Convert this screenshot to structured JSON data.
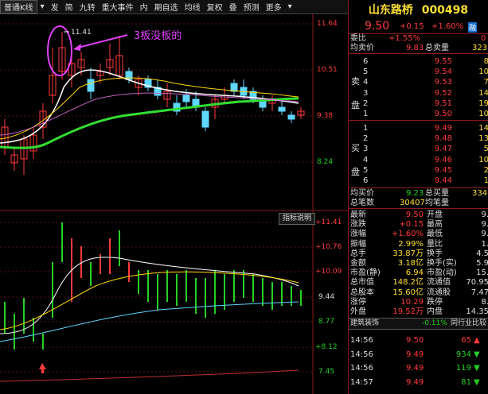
{
  "toolbar": {
    "items": [
      "普通K线",
      "发",
      "简",
      "九转",
      "重大事件",
      "内",
      "期自选",
      "均线",
      "复权",
      "叠",
      "预测",
      "更多"
    ]
  },
  "main_axis": {
    "ticks": [
      "11.64",
      "10.51",
      "9.38",
      "8.24"
    ]
  },
  "sub_axis": {
    "ticks": [
      "+11.41",
      "+10.76",
      "+10.09",
      "9.44",
      "8.77",
      "+8.12",
      "7.45"
    ]
  },
  "annotation": {
    "price_tag": "11.41",
    "note": "3板没板的"
  },
  "indicator_button": "指标说明",
  "stock": {
    "name": "山东路桥",
    "code": "000498",
    "price": "9.50",
    "change": "+0.15",
    "pct": "+1.60%",
    "flag": "融"
  },
  "weibi": {
    "label": "委比",
    "value": "+1.55%",
    "extra": "0"
  },
  "avg_row": {
    "l1": "均卖价",
    "v1": "9.83",
    "l2": "总卖量",
    "v2": "323"
  },
  "sell": {
    "side_label": "卖盘",
    "rows": [
      {
        "lvl": "6",
        "price": "9.55",
        "vol": "8"
      },
      {
        "lvl": "5",
        "price": "9.54",
        "vol": "10"
      },
      {
        "lvl": "4",
        "price": "9.53",
        "vol": "7"
      },
      {
        "lvl": "3",
        "price": "9.52",
        "vol": "14"
      },
      {
        "lvl": "2",
        "price": "9.51",
        "vol": "19"
      },
      {
        "lvl": "1",
        "price": "9.50",
        "vol": "10"
      }
    ]
  },
  "buy": {
    "side_label": "买盘",
    "rows": [
      {
        "lvl": "1",
        "price": "9.49",
        "vol": "14"
      },
      {
        "lvl": "2",
        "price": "9.48",
        "vol": "13"
      },
      {
        "lvl": "3",
        "price": "9.47",
        "vol": "5"
      },
      {
        "lvl": "4",
        "price": "9.46",
        "vol": "10"
      },
      {
        "lvl": "5",
        "price": "9.45",
        "vol": "2"
      },
      {
        "lvl": "6",
        "price": "9.44",
        "vol": "1"
      }
    ]
  },
  "avg_buy": {
    "l1": "均买价",
    "v1": "9.23",
    "l2": "总买量",
    "v2": "334"
  },
  "total_deals": {
    "l1": "总笔数",
    "v1": "30407",
    "l2": "均笔量",
    "v2": ""
  },
  "stats": [
    {
      "l1": "最新",
      "v1": "9.50",
      "c1": "red",
      "l2": "开盘",
      "v2": "9."
    },
    {
      "l1": "涨跌",
      "v1": "+0.15",
      "c1": "red",
      "l2": "最高",
      "v2": "9."
    },
    {
      "l1": "涨幅",
      "v1": "+1.60%",
      "c1": "red",
      "l2": "最低",
      "v2": "9."
    },
    {
      "l1": "振幅",
      "v1": "2.99%",
      "c1": "yel",
      "l2": "量比",
      "v2": "1."
    },
    {
      "l1": "总手",
      "v1": "33.87万",
      "c1": "yel",
      "l2": "换手",
      "v2": "4.5"
    },
    {
      "l1": "金额",
      "v1": "3.18亿",
      "c1": "yel",
      "l2": "换手(实)",
      "v2": "5.9"
    },
    {
      "l1": "市盈(静)",
      "v1": "6.94",
      "c1": "yel",
      "l2": "市盈(动)",
      "v2": "15."
    },
    {
      "l1": "总市值",
      "v1": "148.2亿",
      "c1": "yel",
      "l2": "流通值",
      "v2": "70.95"
    },
    {
      "l1": "总股本",
      "v1": "15.60亿",
      "c1": "yel",
      "l2": "流通股",
      "v2": "7.47"
    },
    {
      "l1": "涨停",
      "v1": "10.29",
      "c1": "red",
      "l2": "跌停",
      "v2": "8."
    },
    {
      "l1": "外盘",
      "v1": "19.52万",
      "c1": "red",
      "l2": "内盘",
      "v2": "14.35"
    }
  ],
  "sector": {
    "name": "建筑装饰",
    "pct": "-0.11%",
    "link": "同行业比较"
  },
  "ticks": [
    {
      "time": "14:56",
      "price": "9.50",
      "vol": "65",
      "dir": "up"
    },
    {
      "time": "14:56",
      "price": "9.49",
      "vol": "934",
      "dir": "down"
    },
    {
      "time": "14:56",
      "price": "9.49",
      "vol": "119",
      "dir": "down"
    },
    {
      "time": "14:57",
      "price": "9.49",
      "vol": "81",
      "dir": "down"
    }
  ],
  "colors": {
    "up": "#ff3b3b",
    "down": "#26d026",
    "accent": "#e040fb",
    "ma_green": "#33dd33"
  }
}
